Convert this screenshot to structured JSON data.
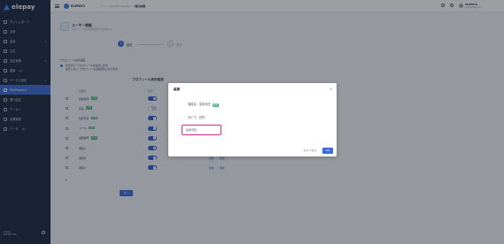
{
  "sidebar": {
    "logo": "elepay",
    "items": [
      {
        "label": "ダッシュボード",
        "badge": ""
      },
      {
        "label": "決済",
        "badge": ""
      },
      {
        "label": "返金",
        "badge": ""
      },
      {
        "label": "注文",
        "badge": ""
      },
      {
        "label": "支払管理",
        "badge": ""
      },
      {
        "label": "顧客",
        "badge": "(β)"
      },
      {
        "label": "サービス設定",
        "badge": ""
      },
      {
        "label": "MiniFeature",
        "badge": ""
      },
      {
        "label": "発行設定",
        "badge": ""
      },
      {
        "label": "クーポン",
        "badge": ""
      },
      {
        "label": "店舗管理",
        "badge": ""
      },
      {
        "label": "データ",
        "badge": "(β)"
      }
    ],
    "footer_line1": "elepay",
    "footer_line2": "ELEPAY INC."
  },
  "topbar": {
    "app_name": "ELEPAY2",
    "crumb_prefix": "ツール / Gen25 / elepay... /",
    "crumb_current": "項目詳細",
    "user_name": "ELEPAY2",
    "user_email": "user@elepay.io"
  },
  "page": {
    "title": "ユーザー情報",
    "subtitle": "プロフィールの表示項目をカスタマイズ",
    "step1_num": "1",
    "step1_label": "設定",
    "step2_num": "2",
    "step2_label": "完了",
    "section_label": "* プロフィール表示設定",
    "radio_line1": "表示する（プロフィールを表示します。",
    "radio_line2": "表示しない（プロフィールは非表示になります。",
    "table_title": "プロフィール表示設定",
    "col_name": "項目名",
    "col_display": "表示",
    "required_tag": "必須",
    "edit": "編集",
    "delete": "削除",
    "add": "+",
    "next_button": "次へ"
  },
  "rows": [
    {
      "name": "会員番号",
      "required": true,
      "on": true,
      "actions": false
    },
    {
      "name": "氏名",
      "required": true,
      "on": false,
      "actions": false
    },
    {
      "name": "生年月日",
      "required": true,
      "on": true,
      "actions": false
    },
    {
      "name": "メール",
      "required": true,
      "on": true,
      "actions": false
    },
    {
      "name": "電話番号",
      "required": true,
      "on": true,
      "actions": false
    },
    {
      "name": "項目A",
      "required": false,
      "on": true,
      "actions": false
    },
    {
      "name": "項目B",
      "required": false,
      "on": true,
      "actions": true
    },
    {
      "name": "項目C",
      "required": false,
      "on": true,
      "actions": true
    }
  ],
  "modal": {
    "title": "編集",
    "field_label": "項目名：",
    "field_value": "生年月日",
    "required_tag": "必須",
    "type_label": "タイプ：",
    "type_value": "日付",
    "input_value": "生年月日",
    "cancel": "キャンセル",
    "ok": "OK"
  },
  "colors": {
    "primary": "#3a6fd9",
    "sidebar": "#1f2a44",
    "required": "#4cb57a",
    "highlight": "#e0288f"
  }
}
